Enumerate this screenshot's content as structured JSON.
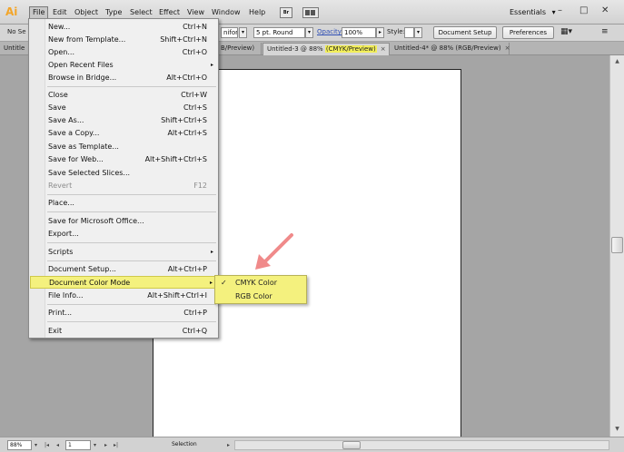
{
  "app": {
    "logo": "Ai"
  },
  "menubar": {
    "items": [
      {
        "label": "File",
        "active": true
      },
      {
        "label": "Edit"
      },
      {
        "label": "Object"
      },
      {
        "label": "Type"
      },
      {
        "label": "Select"
      },
      {
        "label": "Effect"
      },
      {
        "label": "View"
      },
      {
        "label": "Window"
      },
      {
        "label": "Help"
      }
    ],
    "bridge_icon": "Br",
    "workspace": "Essentials",
    "workspace_arrow": "▾",
    "win_controls": [
      "–",
      "□",
      "✕"
    ]
  },
  "controlbar": {
    "no_selection": "No Se",
    "uniform": "niform",
    "brush": "5 pt. Round",
    "opacity_label": "Opacity:",
    "opacity_value": "100%",
    "style_label": "Style:",
    "document_setup": "Document Setup",
    "preferences": "Preferences"
  },
  "tabs": [
    {
      "label": "Untitle",
      "active": false
    },
    {
      "label": "B/Preview)",
      "active": false
    },
    {
      "label_prefix": "Untitled-3 @ 88% ",
      "label_highlight": "(CMYK/Preview)",
      "active": true,
      "close": "×"
    },
    {
      "label": "Untitled-4* @ 88% (RGB/Preview)",
      "active": false,
      "close": "×"
    }
  ],
  "file_menu": {
    "items": [
      {
        "label": "New...",
        "shortcut": "Ctrl+N"
      },
      {
        "label": "New from Template...",
        "shortcut": "Shift+Ctrl+N"
      },
      {
        "label": "Open...",
        "shortcut": "Ctrl+O"
      },
      {
        "label": "Open Recent Files",
        "shortcut": "",
        "submenu": true
      },
      {
        "label": "Browse in Bridge...",
        "shortcut": "Alt+Ctrl+O"
      },
      {
        "label": "Close",
        "shortcut": "Ctrl+W"
      },
      {
        "label": "Save",
        "shortcut": "Ctrl+S"
      },
      {
        "label": "Save As...",
        "shortcut": "Shift+Ctrl+S"
      },
      {
        "label": "Save a Copy...",
        "shortcut": "Alt+Ctrl+S"
      },
      {
        "label": "Save as Template...",
        "shortcut": ""
      },
      {
        "label": "Save for Web...",
        "shortcut": "Alt+Shift+Ctrl+S"
      },
      {
        "label": "Save Selected Slices...",
        "shortcut": ""
      },
      {
        "label": "Revert",
        "shortcut": "F12",
        "disabled": true
      },
      {
        "label": "Place...",
        "shortcut": ""
      },
      {
        "label": "Save for Microsoft Office...",
        "shortcut": ""
      },
      {
        "label": "Export...",
        "shortcut": ""
      },
      {
        "label": "Scripts",
        "shortcut": "",
        "submenu": true
      },
      {
        "label": "Document Setup...",
        "shortcut": "Alt+Ctrl+P"
      },
      {
        "label": "Document Color Mode",
        "shortcut": "",
        "submenu": true,
        "highlighted": true
      },
      {
        "label": "File Info...",
        "shortcut": "Alt+Shift+Ctrl+I"
      },
      {
        "label": "Print...",
        "shortcut": "Ctrl+P"
      },
      {
        "label": "Exit",
        "shortcut": "Ctrl+Q"
      }
    ],
    "submenu_arrow": "▸"
  },
  "color_mode_submenu": {
    "items": [
      {
        "label": "CMYK Color",
        "checked": true
      },
      {
        "label": "RGB Color",
        "checked": false
      }
    ],
    "check": "✓"
  },
  "statusbar": {
    "zoom": "88%",
    "artboard": "1",
    "tool": "Selection"
  },
  "colors": {
    "highlight": "#f4f17e",
    "annotation_arrow": "#f08a8a",
    "logo": "#f3a529"
  }
}
